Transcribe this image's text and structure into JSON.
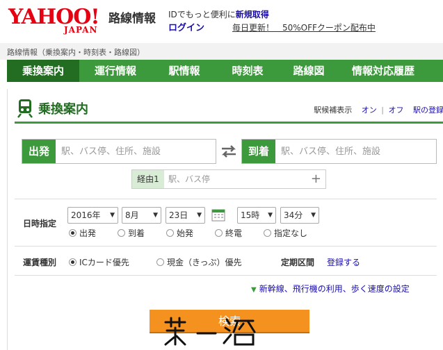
{
  "header": {
    "logo_main": "YAHOO!",
    "logo_sub": "JAPAN",
    "service_name": "路線情報",
    "id_prompt": "IDでもっと便利に",
    "id_register": "新規取得",
    "login": "ログイン",
    "promo": "毎日更新！　50%OFFクーポン配布中"
  },
  "breadcrumb": "路線情報（乗換案内・時刻表・路線図）",
  "nav": {
    "tabs": [
      {
        "label": "乗換案内"
      },
      {
        "label": "運行情報"
      },
      {
        "label": "駅情報"
      },
      {
        "label": "時刻表"
      },
      {
        "label": "路線図"
      },
      {
        "label": "情報対応履歴"
      }
    ]
  },
  "panel": {
    "title": "乗換案内",
    "station_hint_label": "駅候補表示",
    "station_hint_on": "オン",
    "station_hint_sep": "|",
    "station_hint_off": "オフ",
    "station_register": "駅の登録"
  },
  "route": {
    "from_label": "出発",
    "from_placeholder": "駅、バス停、住所、施設",
    "to_label": "到着",
    "to_placeholder": "駅、バス停、住所、施設",
    "via_label": "経由1",
    "via_placeholder": "駅、バス停",
    "add_via": "+"
  },
  "datetime": {
    "label": "日時指定",
    "year": "2016年",
    "month": "8月",
    "day": "23日",
    "hour": "15時",
    "minute": "34分",
    "options": [
      {
        "label": "出発",
        "selected": true
      },
      {
        "label": "到着",
        "selected": false
      },
      {
        "label": "始発",
        "selected": false
      },
      {
        "label": "終電",
        "selected": false
      },
      {
        "label": "指定なし",
        "selected": false
      }
    ]
  },
  "fare": {
    "label": "運賃種別",
    "options": [
      {
        "label": "ICカード優先",
        "selected": true
      },
      {
        "label": "現金（きっぷ）優先",
        "selected": false
      }
    ],
    "teiki_label": "定期区間",
    "teiki_link": "登録する"
  },
  "more_settings": "新幹線、飛行機の利用、歩く速度の設定",
  "search_button": "検索",
  "colors": {
    "brand_red": "#e50012",
    "nav_green": "#3d9a3c",
    "nav_active": "#236d22",
    "search_orange": "#f5911e"
  }
}
